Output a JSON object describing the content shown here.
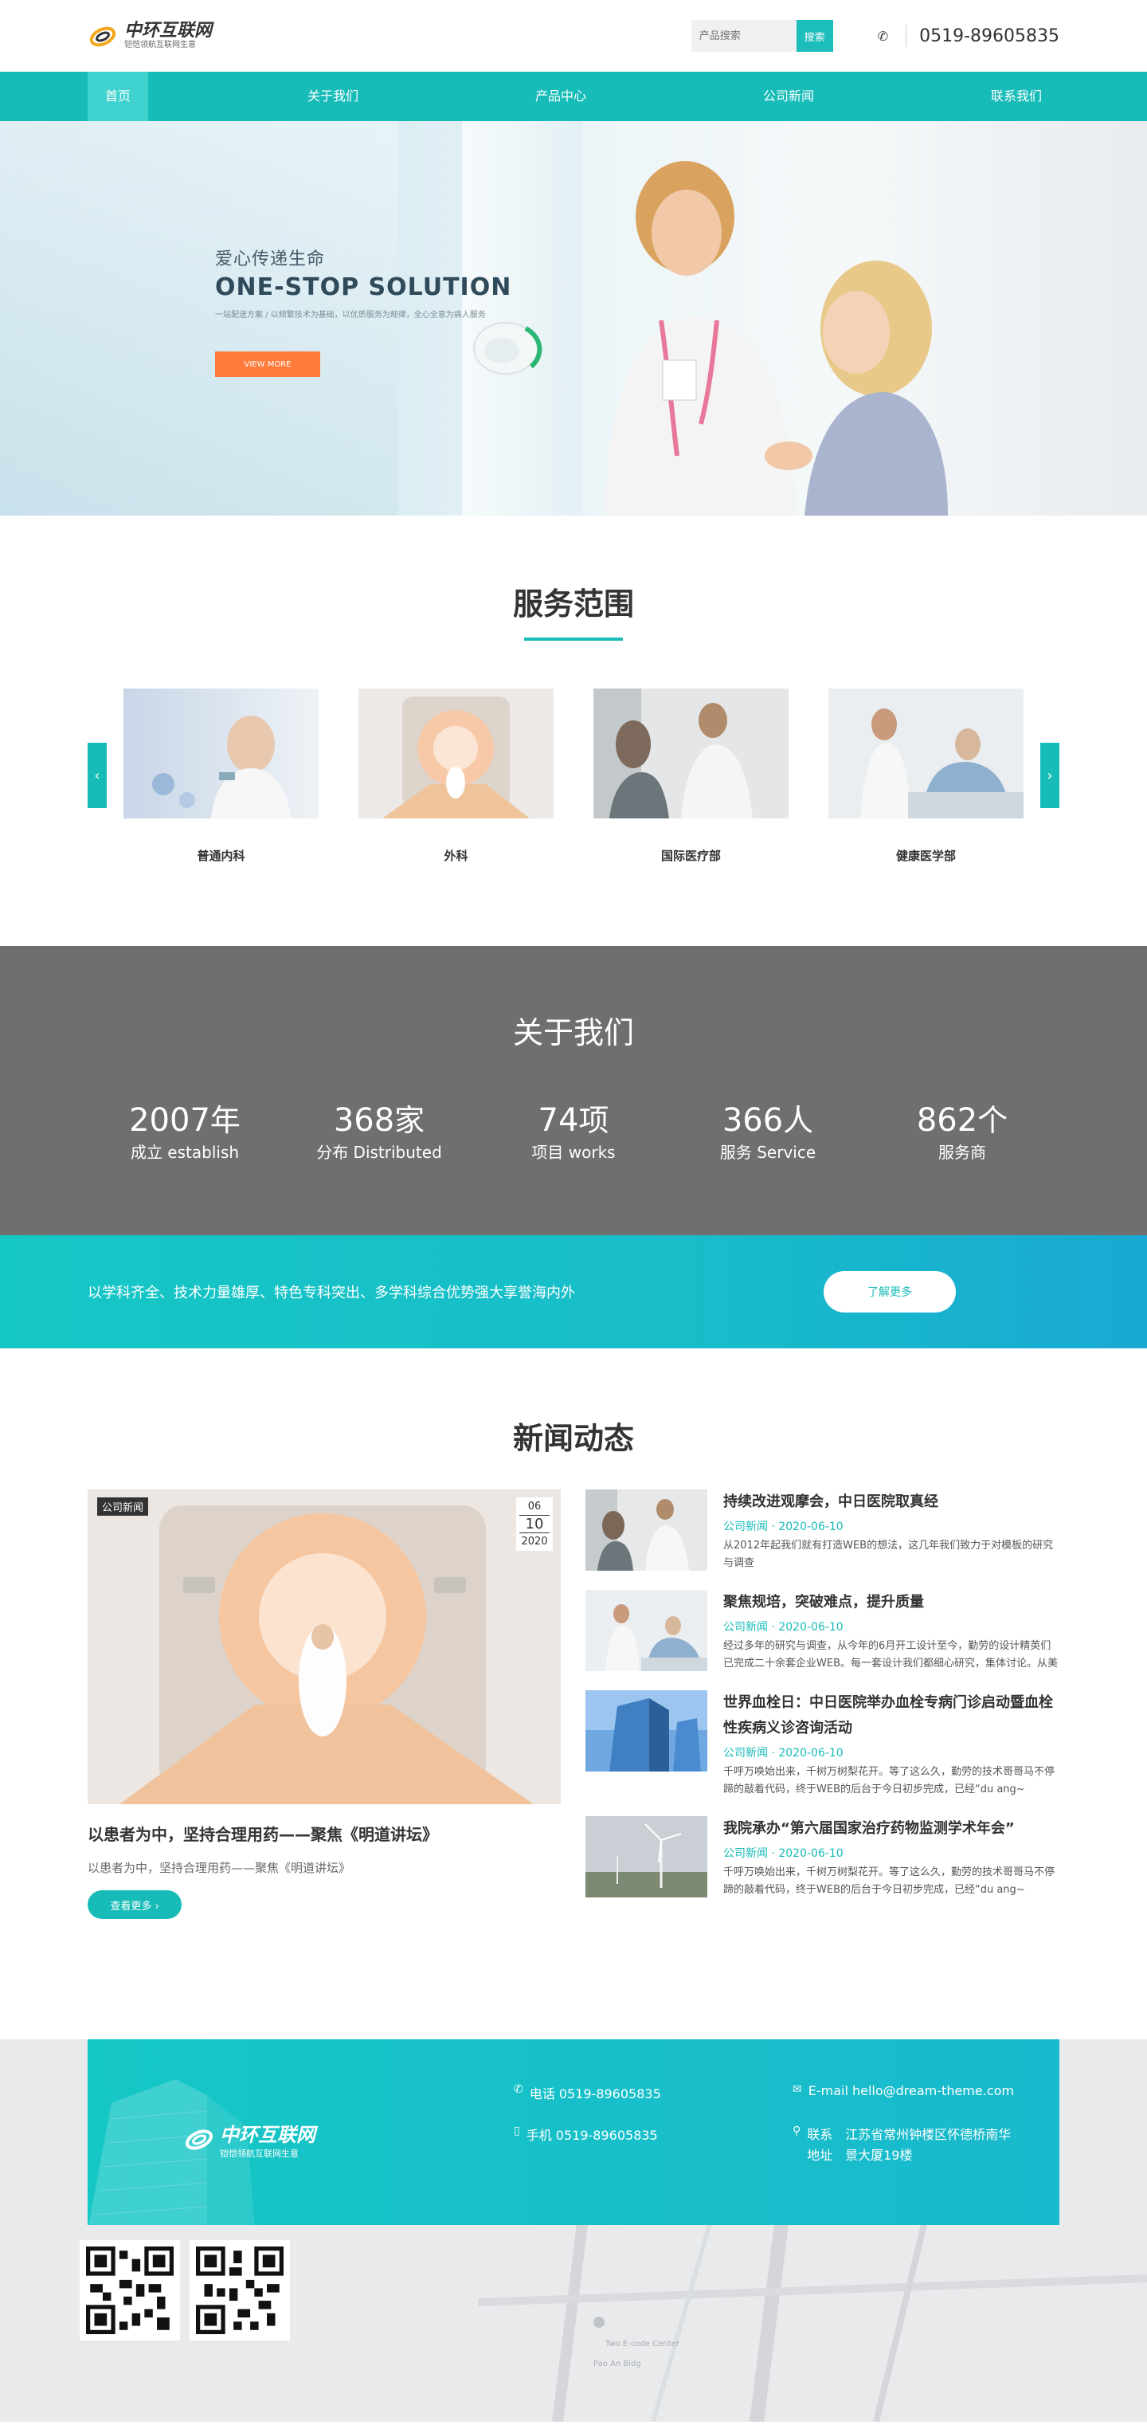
{
  "header": {
    "logo_title": "中环互联网",
    "logo_sub": "铠恺领航互联网生意",
    "search_placeholder": "产品搜索",
    "search_button": "搜索",
    "phone": "0519-89605835",
    "phone_icon": "phone-icon"
  },
  "nav": {
    "items": [
      "首页",
      "关于我们",
      "产品中心",
      "公司新闻",
      "联系我们"
    ]
  },
  "banner": {
    "cn": "爱心传递生命",
    "en": "ONE-STOP SOLUTION",
    "small": "一站配送方案 / 以频繁技术为基础，以优质服务为规律，全心全意为病人服务",
    "button": "VIEW MORE"
  },
  "service": {
    "title": "服务范围",
    "items": [
      {
        "label": "普通内科"
      },
      {
        "label": "外科"
      },
      {
        "label": "国际医疗部"
      },
      {
        "label": "健康医学部"
      }
    ]
  },
  "about": {
    "title": "关于我们",
    "stats": [
      {
        "num": "2007",
        "unit": "年",
        "label": "成立 establish"
      },
      {
        "num": "368",
        "unit": "家",
        "label": "分布 Distributed"
      },
      {
        "num": "74",
        "unit": "项",
        "label": "项目 works"
      },
      {
        "num": "366",
        "unit": "人",
        "label": "服务 Service"
      },
      {
        "num": "862",
        "unit": "个",
        "label": "服务商"
      }
    ]
  },
  "strip": {
    "text": "以学科齐全、技术力量雄厚、特色专科突出、多学科综合优势强大享誉海内外",
    "button": "了解更多"
  },
  "news": {
    "title": "新闻动态",
    "main": {
      "tag": "公司新闻",
      "month": "06",
      "day": "10",
      "year": "2020",
      "headline": "以患者为中，坚持合理用药——聚焦《明道讲坛》",
      "summary": "以患者为中，坚持合理用药——聚焦《明道讲坛》",
      "button": "查看更多 ›"
    },
    "list": [
      {
        "title": "持续改进观摩会，中日医院取真经",
        "meta": "公司新闻 · 2020-06-10",
        "desc": "从2012年起我们就有打造WEB的想法，这几年我们致力于对模板的研究与调查"
      },
      {
        "title": "聚焦规培，突破难点，提升质量",
        "meta": "公司新闻 · 2020-06-10",
        "desc": "经过多年的研究与调查，从今年的6月开工设计至今，勤劳的设计精英们已完成二十余套企业WEB。每一套设计我们都细心研究，集体讨论。从美观度到延展性，从体验度到..."
      },
      {
        "title": "世界血栓日：中日医院举办血栓专病门诊启动暨血栓性疾病义诊咨询活动",
        "meta": "公司新闻 · 2020-06-10",
        "desc": "千呼万唤始出来，千树万树梨花开。等了这么久，勤劳的技术哥哥马不停蹄的敲着代码，终于WEB的后台于今日初步完成，已经“du ang~ duang~”的进入了测（zhao）试（cha）阶段。虽然技术..."
      },
      {
        "title": "我院承办“第六届国家治疗药物监测学术年会”",
        "meta": "公司新闻 · 2020-06-10",
        "desc": "千呼万唤始出来，千树万树梨花开。等了这么久，勤劳的技术哥哥马不停蹄的敲着代码，终于WEB的后台于今日初步完成，已经“du ang~ duang~”的进入了测（zhao）试（cha）阶段。虽然技术..."
      }
    ]
  },
  "footer": {
    "logo_title": "中环互联网",
    "logo_sub": "铠恺领航互联网生意",
    "tel": "电话 0519-89605835",
    "mobile": "手机 0519-89605835",
    "email": "E-mail hello@dream-theme.com",
    "address_label": "联系地址",
    "address": "江苏省常州钟楼区怀德桥南华景大厦19楼",
    "map_labels": [
      "Two E-code Center",
      "Pao An Bldg"
    ]
  },
  "colors": {
    "accent": "#17bcb8",
    "about_bg": "#6f6f6f",
    "banner_button": "#ff7b3b"
  }
}
